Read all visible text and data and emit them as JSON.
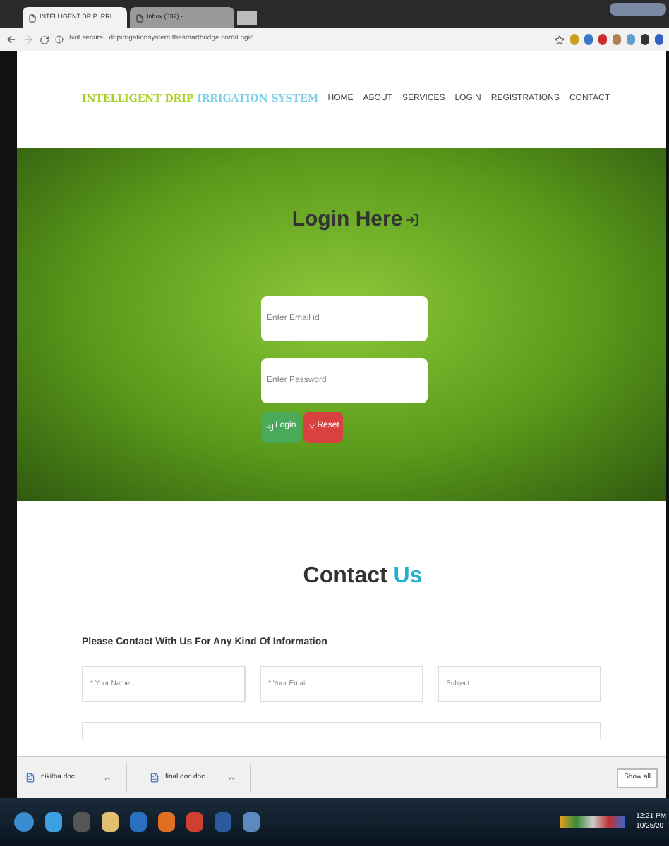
{
  "browser": {
    "tabs": [
      {
        "label": "INTELLIGENT DRIP IRRI",
        "selected": true
      },
      {
        "label": "Inbox (832) -",
        "selected": false
      }
    ],
    "security": "Not secure",
    "url": "dripirrigationsystem.thesmartbridge.com/Login"
  },
  "site": {
    "logo_first": "INTELLIGENT DRIP",
    "logo_second": "IRRIGATION SYSTEM",
    "nav": [
      "HOME",
      "ABOUT",
      "SERVICES",
      "LOGIN",
      "REGISTRATIONS",
      "CONTACT"
    ]
  },
  "login": {
    "title": "Login Here",
    "email_placeholder": "Enter Email id",
    "password_placeholder": "Enter Password",
    "buttons": [
      {
        "label": "Login",
        "kind": "primary"
      },
      {
        "label": "Reset",
        "kind": "danger"
      }
    ]
  },
  "contact": {
    "title_first": "Contact",
    "title_second": "Us",
    "subtitle": "Please Contact With Us For Any Kind Of Information",
    "fields": [
      {
        "placeholder": "* Your Name"
      },
      {
        "placeholder": "* Your Email"
      },
      {
        "placeholder": "Subject"
      }
    ]
  },
  "downloads": {
    "files": [
      "nikitha.doc",
      "final doc.doc"
    ],
    "show_all": "Show all"
  },
  "taskbar": {
    "time": "12:21 PM",
    "date": "10/25/20"
  }
}
